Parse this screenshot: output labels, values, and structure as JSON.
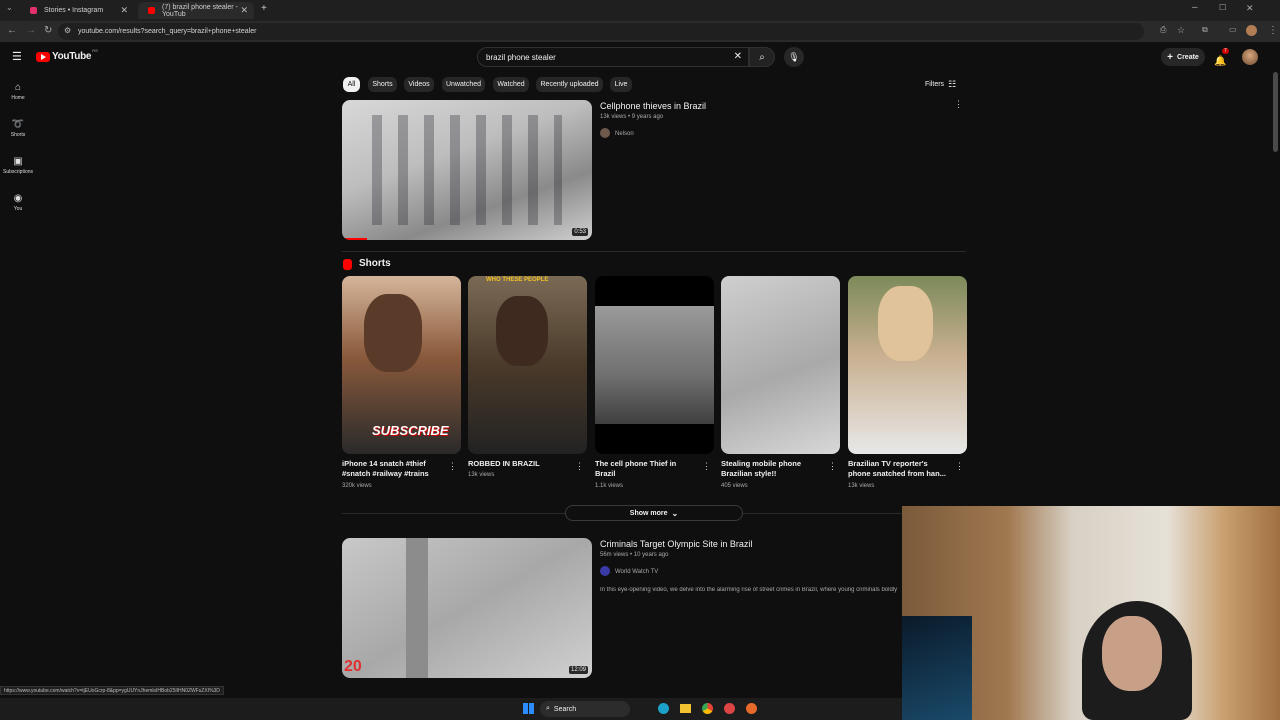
{
  "browser": {
    "tabs": [
      {
        "title": "Stories • Instagram",
        "favicon_color": "#e1306c"
      },
      {
        "title": "(7) brazil phone stealer - YouTub",
        "favicon_color": "#ff0000"
      }
    ],
    "url": "youtube.com/results?search_query=brazil+phone+stealer"
  },
  "header": {
    "logo_text": "YouTube",
    "logo_region": "RS",
    "search_value": "brazil phone stealer",
    "create_label": "Create",
    "notification_count": "7"
  },
  "sidebar": {
    "items": [
      {
        "label": "Home",
        "icon": "home-icon"
      },
      {
        "label": "Shorts",
        "icon": "shorts-icon"
      },
      {
        "label": "Subscriptions",
        "icon": "subscriptions-icon"
      },
      {
        "label": "You",
        "icon": "you-icon"
      }
    ]
  },
  "filters": {
    "chips": [
      "All",
      "Shorts",
      "Videos",
      "Unwatched",
      "Watched",
      "Recently uploaded",
      "Live"
    ],
    "active": "All",
    "filters_label": "Filters"
  },
  "results": {
    "video1": {
      "title": "Cellphone thieves in Brazil",
      "meta": "13k views • 9 years ago",
      "channel": "Nelson",
      "duration": "0:53"
    },
    "shorts_heading": "Shorts",
    "shorts": [
      {
        "title": "iPhone 14 snatch #thief #snatch #railway #trains",
        "views": "320k views",
        "overlay": "SUBSCRIBE"
      },
      {
        "title": "ROBBED IN BRAZIL",
        "views": "13k views",
        "overlay": "WHO THESE PEOPLE"
      },
      {
        "title": "The cell phone Thief in Brazil",
        "views": "1.1k views",
        "overlay": ""
      },
      {
        "title": "Stealing mobile phone Brazilian style!!",
        "views": "405 views",
        "overlay": ""
      },
      {
        "title": "Brazilian TV reporter's phone snatched from han...",
        "views": "13k views",
        "overlay": ""
      }
    ],
    "show_more_label": "Show more",
    "video2": {
      "title": "Criminals Target Olympic Site in Brazil",
      "meta": "56m views • 10 years ago",
      "channel": "World Watch TV",
      "description": "In this eye-opening video, we delve into the alarming rise of street crimes in Brazil, where young criminals boldly",
      "duration": "12:09",
      "overlay_number": "20"
    }
  },
  "statusbar": {
    "url": "https://www.youtube.com/watch?v=tjEUoGcrp-8&pp=ygUUYnJhemlsIHBob25lIHN0ZWFsZXI%3D"
  },
  "taskbar": {
    "search_label": "Search"
  },
  "colors": {
    "background": "#0f0f0f",
    "brand_red": "#ff0000",
    "chip_bg": "#272727"
  }
}
